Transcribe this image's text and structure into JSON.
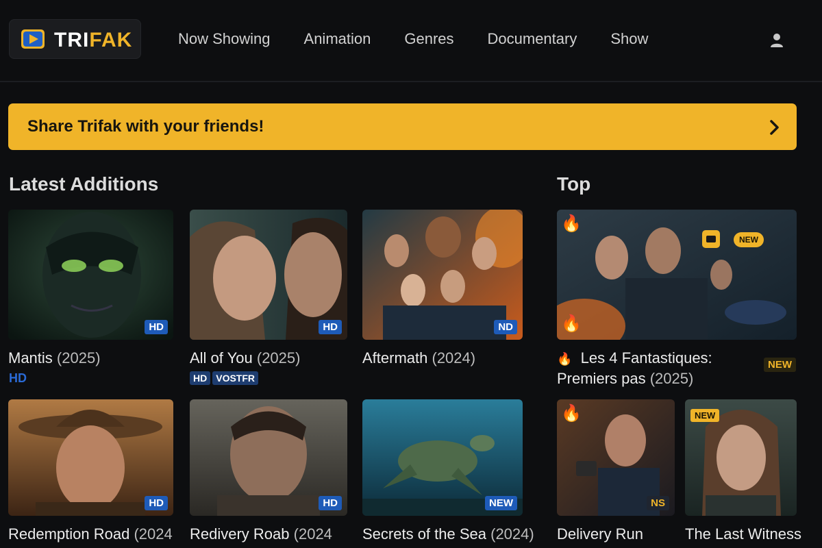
{
  "logo": {
    "part1": "TRI",
    "part2": "FAK"
  },
  "nav": [
    "Now Showing",
    "Animation",
    "Genres",
    "Documentary",
    "Show"
  ],
  "banner": {
    "text": "Share Trifak with your friends!"
  },
  "latest": {
    "title": "Latest Additions",
    "items": [
      {
        "title": "Mantis",
        "year": "(2025)",
        "badge": "HD",
        "tags": [
          "HD"
        ]
      },
      {
        "title": "All of You",
        "year": "(2025)",
        "badge": "HD",
        "tags": [
          "HD",
          "VOSTFR"
        ]
      },
      {
        "title": "Aftermath",
        "year": "(2024)",
        "badge": "ND"
      },
      {
        "title": "Redemption Road",
        "year": "(2024",
        "badge": "HD"
      },
      {
        "title": "Redivery Roab",
        "year": "(2024",
        "badge": "HD"
      },
      {
        "title": "Secrets of the Sea",
        "year": "(2024)",
        "badge": "NEW"
      }
    ]
  },
  "top": {
    "title": "Top",
    "featured": {
      "title_line1": "Les 4 Fantastiques:",
      "title_line2": "Premiers pas",
      "year": "(2025)",
      "badge": "NEW",
      "poster_badge": "NEW"
    },
    "items": [
      {
        "title": "Delivery Run",
        "badge": "NS"
      },
      {
        "title": "The Last Witness",
        "badge": "NEW"
      }
    ]
  },
  "colors": {
    "accent": "#f0b429",
    "badge_blue": "#1e5bb8",
    "background": "#0d0e10"
  },
  "icons": {
    "logo": "play-icon",
    "user": "user-icon",
    "banner": "chevron-right-icon",
    "fire": "fire-icon"
  }
}
